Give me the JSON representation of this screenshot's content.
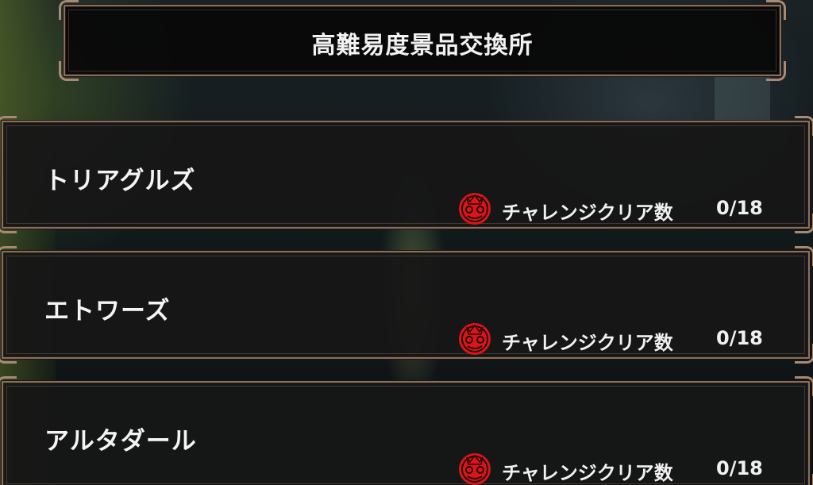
{
  "header": {
    "title": "高難易度景品交換所"
  },
  "progress_label": "チャレンジクリア数",
  "medal_icon": "red-demon-medal-icon",
  "colors": {
    "medal": "#d8161c",
    "frame": "#8a6f5c"
  },
  "cards": [
    {
      "name": "トリアグルズ",
      "progress": "0/18"
    },
    {
      "name": "エトワーズ",
      "progress": "0/18"
    },
    {
      "name": "アルタダール",
      "progress": "0/18"
    }
  ]
}
